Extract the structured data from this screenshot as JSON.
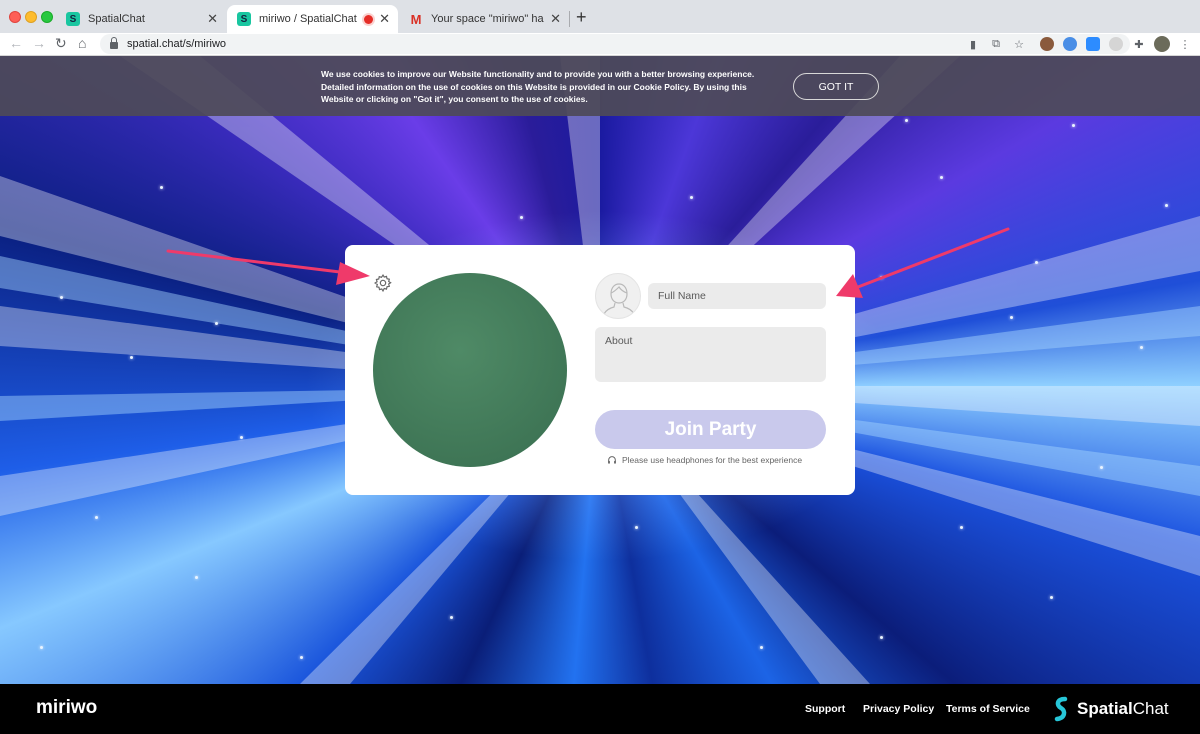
{
  "browser": {
    "tabs": [
      {
        "title": "SpatialChat",
        "favicon": "spatialchat-icon"
      },
      {
        "title": "miriwo / SpatialChat",
        "favicon": "spatialchat-icon"
      },
      {
        "title": "Your space \"miriwo\" has been",
        "favicon": "gmail-icon"
      }
    ],
    "url": "spatial.chat/s/miriwo"
  },
  "cookie": {
    "text": "We use cookies to improve our Website functionality and to provide you with a better browsing experience. Detailed information on the use of cookies on this Website is provided in our Cookie Policy. By using this Website or clicking on \"Got it\", you consent to the use of cookies.",
    "button": "GOT IT"
  },
  "form": {
    "name_placeholder": "Full Name",
    "about_placeholder": "About",
    "join_label": "Join Party",
    "hint": "Please use headphones for the best experience"
  },
  "footer": {
    "space_name": "miriwo",
    "links": [
      "Support",
      "Privacy Policy",
      "Terms of Service"
    ],
    "brand_bold": "Spatial",
    "brand_rest": "Chat"
  },
  "colors": {
    "join_button": "#c9c9ec",
    "arrow": "#ef3a6a",
    "video_bg": "#467f5d"
  }
}
